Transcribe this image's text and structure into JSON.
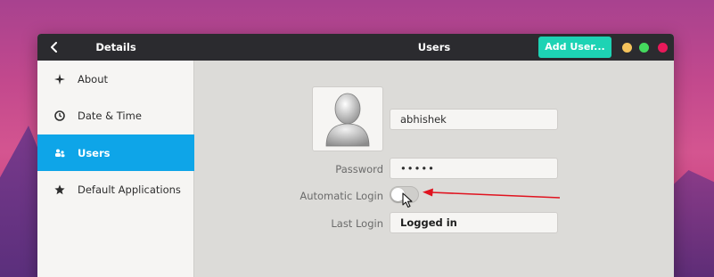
{
  "titlebar": {
    "sidebar_title": "Details",
    "main_title": "Users",
    "add_user_label": "Add User..."
  },
  "sidebar": {
    "items": [
      {
        "label": "About",
        "icon": "star-sparkle-icon",
        "active": false
      },
      {
        "label": "Date & Time",
        "icon": "clock-icon",
        "active": false
      },
      {
        "label": "Users",
        "icon": "users-icon",
        "active": true
      },
      {
        "label": "Default Applications",
        "icon": "star-icon",
        "active": false
      }
    ]
  },
  "user": {
    "name": "abhishek",
    "password_label": "Password",
    "password_value": "•••••",
    "auto_login_label": "Automatic Login",
    "auto_login_enabled": false,
    "last_login_label": "Last Login",
    "last_login_value": "Logged in"
  },
  "colors": {
    "accent_active": "#0ea5e8",
    "add_button": "#1dd3b4",
    "annotation_arrow": "#e0131f",
    "window_min": "#f5c35c",
    "window_max": "#44d95e",
    "window_close": "#e8195a"
  }
}
